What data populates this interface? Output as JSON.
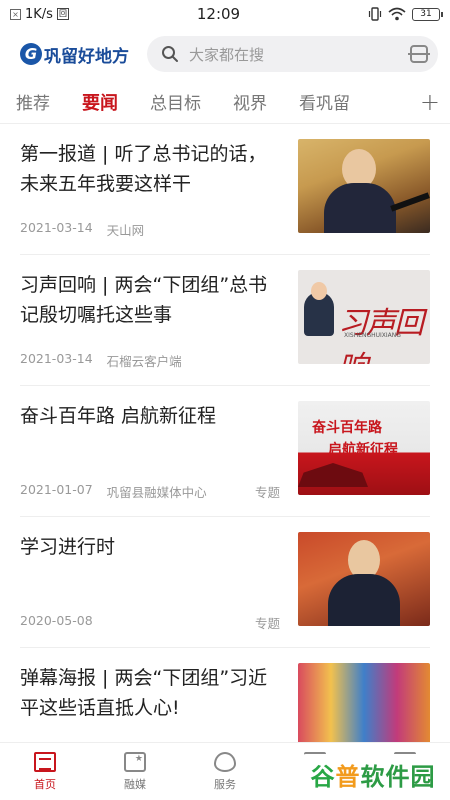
{
  "status_bar": {
    "speed": "1K/s",
    "time": "12:09",
    "battery": "31"
  },
  "header": {
    "logo_text": "巩留好地方",
    "search_placeholder": "大家都在搜"
  },
  "tabs": [
    {
      "label": "推荐",
      "active": false
    },
    {
      "label": "要闻",
      "active": true
    },
    {
      "label": "总目标",
      "active": false
    },
    {
      "label": "视界",
      "active": false
    },
    {
      "label": "看巩留",
      "active": false
    }
  ],
  "news": [
    {
      "title": "第一报道 | 听了总书记的话，未来五年我要这样干",
      "date": "2021-03-14",
      "source": "天山网",
      "tag": ""
    },
    {
      "title": "习声回响 | 两会“下团组”总书记殷切嘱托这些事",
      "date": "2021-03-14",
      "source": "石榴云客户端",
      "tag": "",
      "thumb_caption": "习声回响",
      "thumb_sub": "XISHENGHUIXIANG"
    },
    {
      "title": "奋斗百年路 启航新征程",
      "date": "2021-01-07",
      "source": "巩留县融媒体中心",
      "tag": "专题",
      "thumb_line1": "奋斗百年路",
      "thumb_line2": "启航新征程"
    },
    {
      "title": "学习进行时",
      "date": "2020-05-08",
      "source": "",
      "tag": "专题"
    },
    {
      "title": "弹幕海报 | 两会“下团组”习近平这些话直抵人心!",
      "date": "",
      "source": "",
      "tag": ""
    }
  ],
  "bottom_nav": [
    {
      "label": "首页",
      "active": true
    },
    {
      "label": "融媒",
      "active": false
    },
    {
      "label": "服务",
      "active": false
    },
    {
      "label": "报料",
      "active": false
    },
    {
      "label": "我",
      "active": false
    }
  ],
  "watermark": {
    "part1": "谷",
    "part2": "普",
    "part3": "软件园"
  }
}
